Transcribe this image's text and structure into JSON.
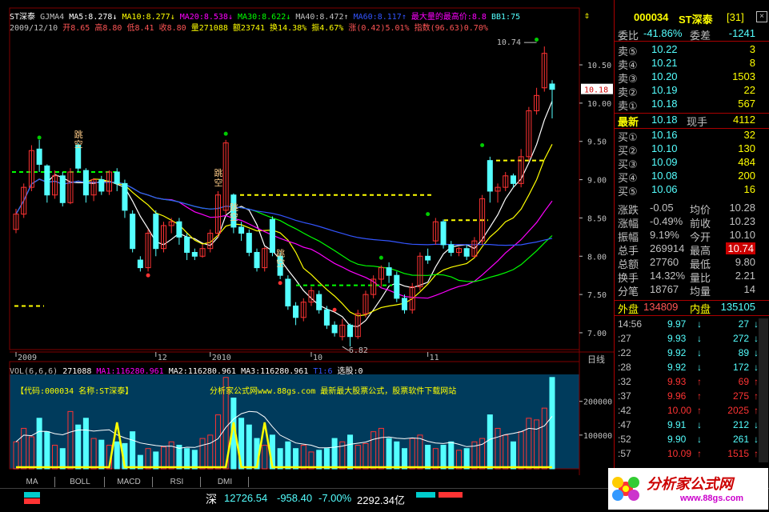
{
  "header": {
    "name": "ST深泰",
    "gjma_label": "GJMA4",
    "ma5": "MA5:8.278",
    "ma10": "MA10:8.277",
    "ma20": "MA20:8.538",
    "ma30": "MA30:8.622",
    "ma40": "MA40:8.472",
    "ma60": "MA60:8.117",
    "max_price_label": "最大量的最高价:8.8",
    "bb": "BB1:75",
    "line2_date": "2009/12/10",
    "line2_open": "开8.65",
    "line2_high": "高8.80",
    "line2_low": "低8.41",
    "line2_close": "收8.80",
    "line2_vol": "量271088",
    "line2_amount": "额23741",
    "line2_turnover": "换14.38%",
    "line2_amp": "振4.67%",
    "line2_change": "涨(0.42)5.01%",
    "line2_index": "指数(96.63)0.70%"
  },
  "chart_labels": {
    "jump1": "跳空",
    "jump2": "跳空",
    "jump3": "跳空",
    "jump4": "跳空",
    "high_mark": "10.74",
    "low_mark": "6.82",
    "price_tag": "10.18",
    "right_axis_label": "日线"
  },
  "chart_data": {
    "type": "candlestick",
    "yticks": [
      "10.50",
      "10.00",
      "9.50",
      "9.00",
      "8.50",
      "8.00",
      "7.50",
      "7.00"
    ],
    "ylim": [
      6.78,
      10.95
    ],
    "x_labels": [
      {
        "label": "2009",
        "i": 0
      },
      {
        "label": "12",
        "i": 18
      },
      {
        "label": "2010",
        "i": 25
      },
      {
        "label": "10",
        "i": 38
      },
      {
        "label": "11",
        "i": 53
      }
    ],
    "candles": [
      {
        "o": 8.35,
        "c": 8.55,
        "h": 8.62,
        "l": 8.3
      },
      {
        "o": 8.55,
        "c": 8.9,
        "h": 8.95,
        "l": 8.5
      },
      {
        "o": 8.9,
        "c": 9.38,
        "h": 9.45,
        "l": 8.85
      },
      {
        "o": 9.4,
        "c": 9.2,
        "h": 9.52,
        "l": 9.1
      },
      {
        "o": 9.18,
        "c": 8.8,
        "h": 9.2,
        "l": 8.7
      },
      {
        "o": 8.8,
        "c": 9.05,
        "h": 9.12,
        "l": 8.75
      },
      {
        "o": 9.05,
        "c": 8.7,
        "h": 9.1,
        "l": 8.65
      },
      {
        "o": 8.7,
        "c": 9.1,
        "h": 9.15,
        "l": 8.68
      },
      {
        "o": 9.45,
        "c": 9.15,
        "h": 9.48,
        "l": 9.1
      },
      {
        "o": 9.12,
        "c": 8.8,
        "h": 9.15,
        "l": 8.7
      },
      {
        "o": 8.8,
        "c": 9.0,
        "h": 9.02,
        "l": 8.72
      },
      {
        "o": 9.0,
        "c": 8.85,
        "h": 9.05,
        "l": 8.8
      },
      {
        "o": 8.85,
        "c": 9.1,
        "h": 9.12,
        "l": 8.8
      },
      {
        "o": 9.1,
        "c": 8.95,
        "h": 9.15,
        "l": 8.85
      },
      {
        "o": 8.95,
        "c": 8.6,
        "h": 9.0,
        "l": 8.5
      },
      {
        "o": 8.55,
        "c": 8.1,
        "h": 8.6,
        "l": 8.05
      },
      {
        "o": 7.95,
        "c": 7.85,
        "h": 8.0,
        "l": 7.8
      },
      {
        "o": 7.85,
        "c": 8.3,
        "h": 8.35,
        "l": 7.8
      },
      {
        "o": 8.55,
        "c": 8.1,
        "h": 8.6,
        "l": 8.0
      },
      {
        "o": 8.1,
        "c": 8.4,
        "h": 8.45,
        "l": 8.05
      },
      {
        "o": 8.4,
        "c": 8.45,
        "h": 8.5,
        "l": 8.3
      },
      {
        "o": 8.45,
        "c": 8.25,
        "h": 8.5,
        "l": 8.15
      },
      {
        "o": 8.25,
        "c": 8.05,
        "h": 8.3,
        "l": 7.95
      },
      {
        "o": 8.05,
        "c": 8.0,
        "h": 8.1,
        "l": 7.95
      },
      {
        "o": 8.0,
        "c": 8.1,
        "h": 8.15,
        "l": 7.98
      },
      {
        "o": 8.1,
        "c": 8.3,
        "h": 8.35,
        "l": 8.05
      },
      {
        "o": 8.3,
        "c": 8.8,
        "h": 8.85,
        "l": 8.25
      },
      {
        "o": 8.6,
        "c": 9.48,
        "h": 9.52,
        "l": 8.55
      },
      {
        "o": 8.8,
        "c": 8.38,
        "h": 8.82,
        "l": 8.3
      },
      {
        "o": 8.38,
        "c": 8.3,
        "h": 8.45,
        "l": 8.2
      },
      {
        "o": 8.3,
        "c": 8.05,
        "h": 8.35,
        "l": 8.0
      },
      {
        "o": 8.05,
        "c": 7.85,
        "h": 8.1,
        "l": 7.8
      },
      {
        "o": 7.85,
        "c": 8.1,
        "h": 8.12,
        "l": 7.8
      },
      {
        "o": 8.48,
        "c": 8.05,
        "h": 8.52,
        "l": 8.0
      },
      {
        "o": 8.0,
        "c": 7.75,
        "h": 8.05,
        "l": 7.7
      },
      {
        "o": 7.7,
        "c": 7.35,
        "h": 7.75,
        "l": 7.3
      },
      {
        "o": 7.35,
        "c": 7.2,
        "h": 7.4,
        "l": 7.1
      },
      {
        "o": 7.2,
        "c": 7.4,
        "h": 7.45,
        "l": 7.15
      },
      {
        "o": 7.4,
        "c": 7.55,
        "h": 7.6,
        "l": 7.35
      },
      {
        "o": 7.5,
        "c": 7.3,
        "h": 7.55,
        "l": 7.25
      },
      {
        "o": 7.3,
        "c": 7.1,
        "h": 7.35,
        "l": 7.05
      },
      {
        "o": 7.1,
        "c": 7.0,
        "h": 7.15,
        "l": 6.95
      },
      {
        "o": 6.95,
        "c": 7.1,
        "h": 7.18,
        "l": 6.9
      },
      {
        "o": 7.1,
        "c": 6.95,
        "h": 7.12,
        "l": 6.82
      },
      {
        "o": 6.95,
        "c": 7.25,
        "h": 7.3,
        "l": 6.92
      },
      {
        "o": 7.25,
        "c": 7.5,
        "h": 7.55,
        "l": 7.2
      },
      {
        "o": 7.5,
        "c": 7.7,
        "h": 7.75,
        "l": 7.45
      },
      {
        "o": 7.7,
        "c": 7.85,
        "h": 7.88,
        "l": 7.6
      },
      {
        "o": 7.85,
        "c": 7.75,
        "h": 7.92,
        "l": 7.65
      },
      {
        "o": 7.75,
        "c": 7.45,
        "h": 7.8,
        "l": 7.4
      },
      {
        "o": 7.45,
        "c": 7.3,
        "h": 7.5,
        "l": 7.25
      },
      {
        "o": 7.3,
        "c": 7.6,
        "h": 7.65,
        "l": 7.25
      },
      {
        "o": 7.6,
        "c": 8.0,
        "h": 8.05,
        "l": 7.55
      },
      {
        "o": 8.0,
        "c": 7.95,
        "h": 8.1,
        "l": 7.9
      },
      {
        "o": 8.2,
        "c": 8.45,
        "h": 8.5,
        "l": 8.15
      },
      {
        "o": 8.45,
        "c": 8.15,
        "h": 8.48,
        "l": 8.1
      },
      {
        "o": 8.15,
        "c": 8.05,
        "h": 8.2,
        "l": 8.0
      },
      {
        "o": 8.05,
        "c": 8.1,
        "h": 8.12,
        "l": 8.0
      },
      {
        "o": 8.1,
        "c": 8.0,
        "h": 8.15,
        "l": 7.95
      },
      {
        "o": 8.0,
        "c": 8.2,
        "h": 8.25,
        "l": 7.98
      },
      {
        "o": 8.2,
        "c": 8.75,
        "h": 8.8,
        "l": 8.15
      },
      {
        "o": 9.25,
        "c": 8.85,
        "h": 9.3,
        "l": 8.7
      },
      {
        "o": 8.85,
        "c": 8.9,
        "h": 8.95,
        "l": 8.7
      },
      {
        "o": 8.9,
        "c": 9.05,
        "h": 9.1,
        "l": 8.85
      },
      {
        "o": 9.05,
        "c": 8.95,
        "h": 9.08,
        "l": 8.9
      },
      {
        "o": 8.95,
        "c": 9.3,
        "h": 9.4,
        "l": 8.9
      },
      {
        "o": 9.3,
        "c": 9.9,
        "h": 9.95,
        "l": 9.25
      },
      {
        "o": 9.9,
        "c": 10.1,
        "h": 10.2,
        "l": 9.85
      },
      {
        "o": 10.2,
        "c": 10.65,
        "h": 10.74,
        "l": 10.15
      },
      {
        "o": 10.25,
        "c": 10.18,
        "h": 10.3,
        "l": 9.8
      }
    ],
    "volumes": [
      80,
      120,
      95,
      150,
      110,
      70,
      60,
      170,
      130,
      150,
      90,
      85,
      70,
      80,
      75,
      110,
      40,
      60,
      50,
      65,
      80,
      70,
      60,
      55,
      90,
      100,
      160,
      271,
      210,
      150,
      130,
      90,
      70,
      100,
      60,
      80,
      60,
      70,
      50,
      55,
      60,
      90,
      80,
      100,
      70,
      75,
      110,
      120,
      90,
      80,
      60,
      90,
      100,
      70,
      60,
      70,
      80,
      55,
      60,
      80,
      90,
      160,
      120,
      100,
      80,
      110,
      150,
      145,
      180,
      271
    ],
    "vol_ylim": [
      0,
      280000
    ],
    "vol_yticks": [
      "200000",
      "100000"
    ],
    "vol_header": {
      "label": "VOL(6,6,6)",
      "value": "271088",
      "ma1": "MA1:116280.961",
      "ma2": "MA2:116280.961",
      "ma3": "MA3:116280.961",
      "t1": "T1:6",
      "sel": "选股:0"
    },
    "vol_overlay_left": "【代码:000034 名称:ST深泰】",
    "vol_overlay_center": "分析家公式网www.88gs.com 最新最大股票公式，股票软件下载网站"
  },
  "tabs": [
    "MA",
    "BOLL",
    "MACD",
    "RSI",
    "DMI"
  ],
  "panel": {
    "code": "000034",
    "name": "ST深泰",
    "rank": "[31]",
    "weibi_label": "委比",
    "weibi_value": "-41.86%",
    "weicha_label": "委差",
    "weicha_value": "-1241",
    "sell": [
      {
        "label": "卖⑤",
        "price": "10.22",
        "vol": "3"
      },
      {
        "label": "卖④",
        "price": "10.21",
        "vol": "8"
      },
      {
        "label": "卖③",
        "price": "10.20",
        "vol": "1503"
      },
      {
        "label": "卖②",
        "price": "10.19",
        "vol": "22"
      },
      {
        "label": "卖①",
        "price": "10.18",
        "vol": "567"
      }
    ],
    "latest_label": "最新",
    "latest_value": "10.18",
    "current_label": "现手",
    "current_value": "4112",
    "buy": [
      {
        "label": "买①",
        "price": "10.16",
        "vol": "32"
      },
      {
        "label": "买②",
        "price": "10.10",
        "vol": "130"
      },
      {
        "label": "买③",
        "price": "10.09",
        "vol": "484"
      },
      {
        "label": "买④",
        "price": "10.08",
        "vol": "200"
      },
      {
        "label": "买⑤",
        "price": "10.06",
        "vol": "16"
      }
    ],
    "stats": [
      {
        "l1": "涨跌",
        "v1": "-0.05",
        "l2": "均价",
        "v2": "10.28"
      },
      {
        "l1": "涨幅",
        "v1": "-0.49%",
        "l2": "前收",
        "v2": "10.23"
      },
      {
        "l1": "振幅",
        "v1": "9.19%",
        "l2": "今开",
        "v2": "10.10"
      },
      {
        "l1": "总手",
        "v1": "269914",
        "l2": "最高",
        "v2": "10.74"
      },
      {
        "l1": "总额",
        "v1": "27760",
        "l2": "最低",
        "v2": "9.80"
      },
      {
        "l1": "换手",
        "v1": "14.32%",
        "l2": "量比",
        "v2": "2.21"
      },
      {
        "l1": "分笔",
        "v1": "18767",
        "l2": "均量",
        "v2": "14"
      }
    ],
    "outer_label": "外盘",
    "outer_value": "134809",
    "inner_label": "内盘",
    "inner_value": "135105",
    "ticks": [
      {
        "t": "14:56",
        "p": "9.97",
        "d": "down",
        "v": "27",
        "vd": "down"
      },
      {
        "t": ":27",
        "p": "9.93",
        "d": "down",
        "v": "272",
        "vd": "down"
      },
      {
        "t": ":22",
        "p": "9.92",
        "d": "down",
        "v": "89",
        "vd": "down"
      },
      {
        "t": ":28",
        "p": "9.92",
        "d": "down",
        "v": "172",
        "vd": "down"
      },
      {
        "t": ":32",
        "p": "9.93",
        "d": "up",
        "v": "69",
        "vd": "up"
      },
      {
        "t": ":37",
        "p": "9.96",
        "d": "up",
        "v": "275",
        "vd": "up"
      },
      {
        "t": ":42",
        "p": "10.00",
        "d": "up",
        "v": "2025",
        "vd": "up"
      },
      {
        "t": ":47",
        "p": "9.91",
        "d": "down",
        "v": "212",
        "vd": "down"
      },
      {
        "t": ":52",
        "p": "9.90",
        "d": "down",
        "v": "261",
        "vd": "down"
      },
      {
        "t": ":57",
        "p": "10.09",
        "d": "up",
        "v": "1515",
        "vd": "up"
      }
    ]
  },
  "status": {
    "market": "深",
    "index": "12726.54",
    "change": "-958.40",
    "pct": "-7.00%",
    "amount": "2292.34亿"
  },
  "logo": {
    "title": "分析家公式网",
    "url": "www.88gs.com"
  },
  "colors": {
    "up": "#ff3333",
    "down": "#54ffff",
    "ma5": "#ffffff",
    "ma10": "#ffff00",
    "ma20": "#ff00ff",
    "ma30": "#00ff00",
    "ma60": "#3355ff",
    "grid": "#800000",
    "vol_bg": "#003b5c"
  }
}
